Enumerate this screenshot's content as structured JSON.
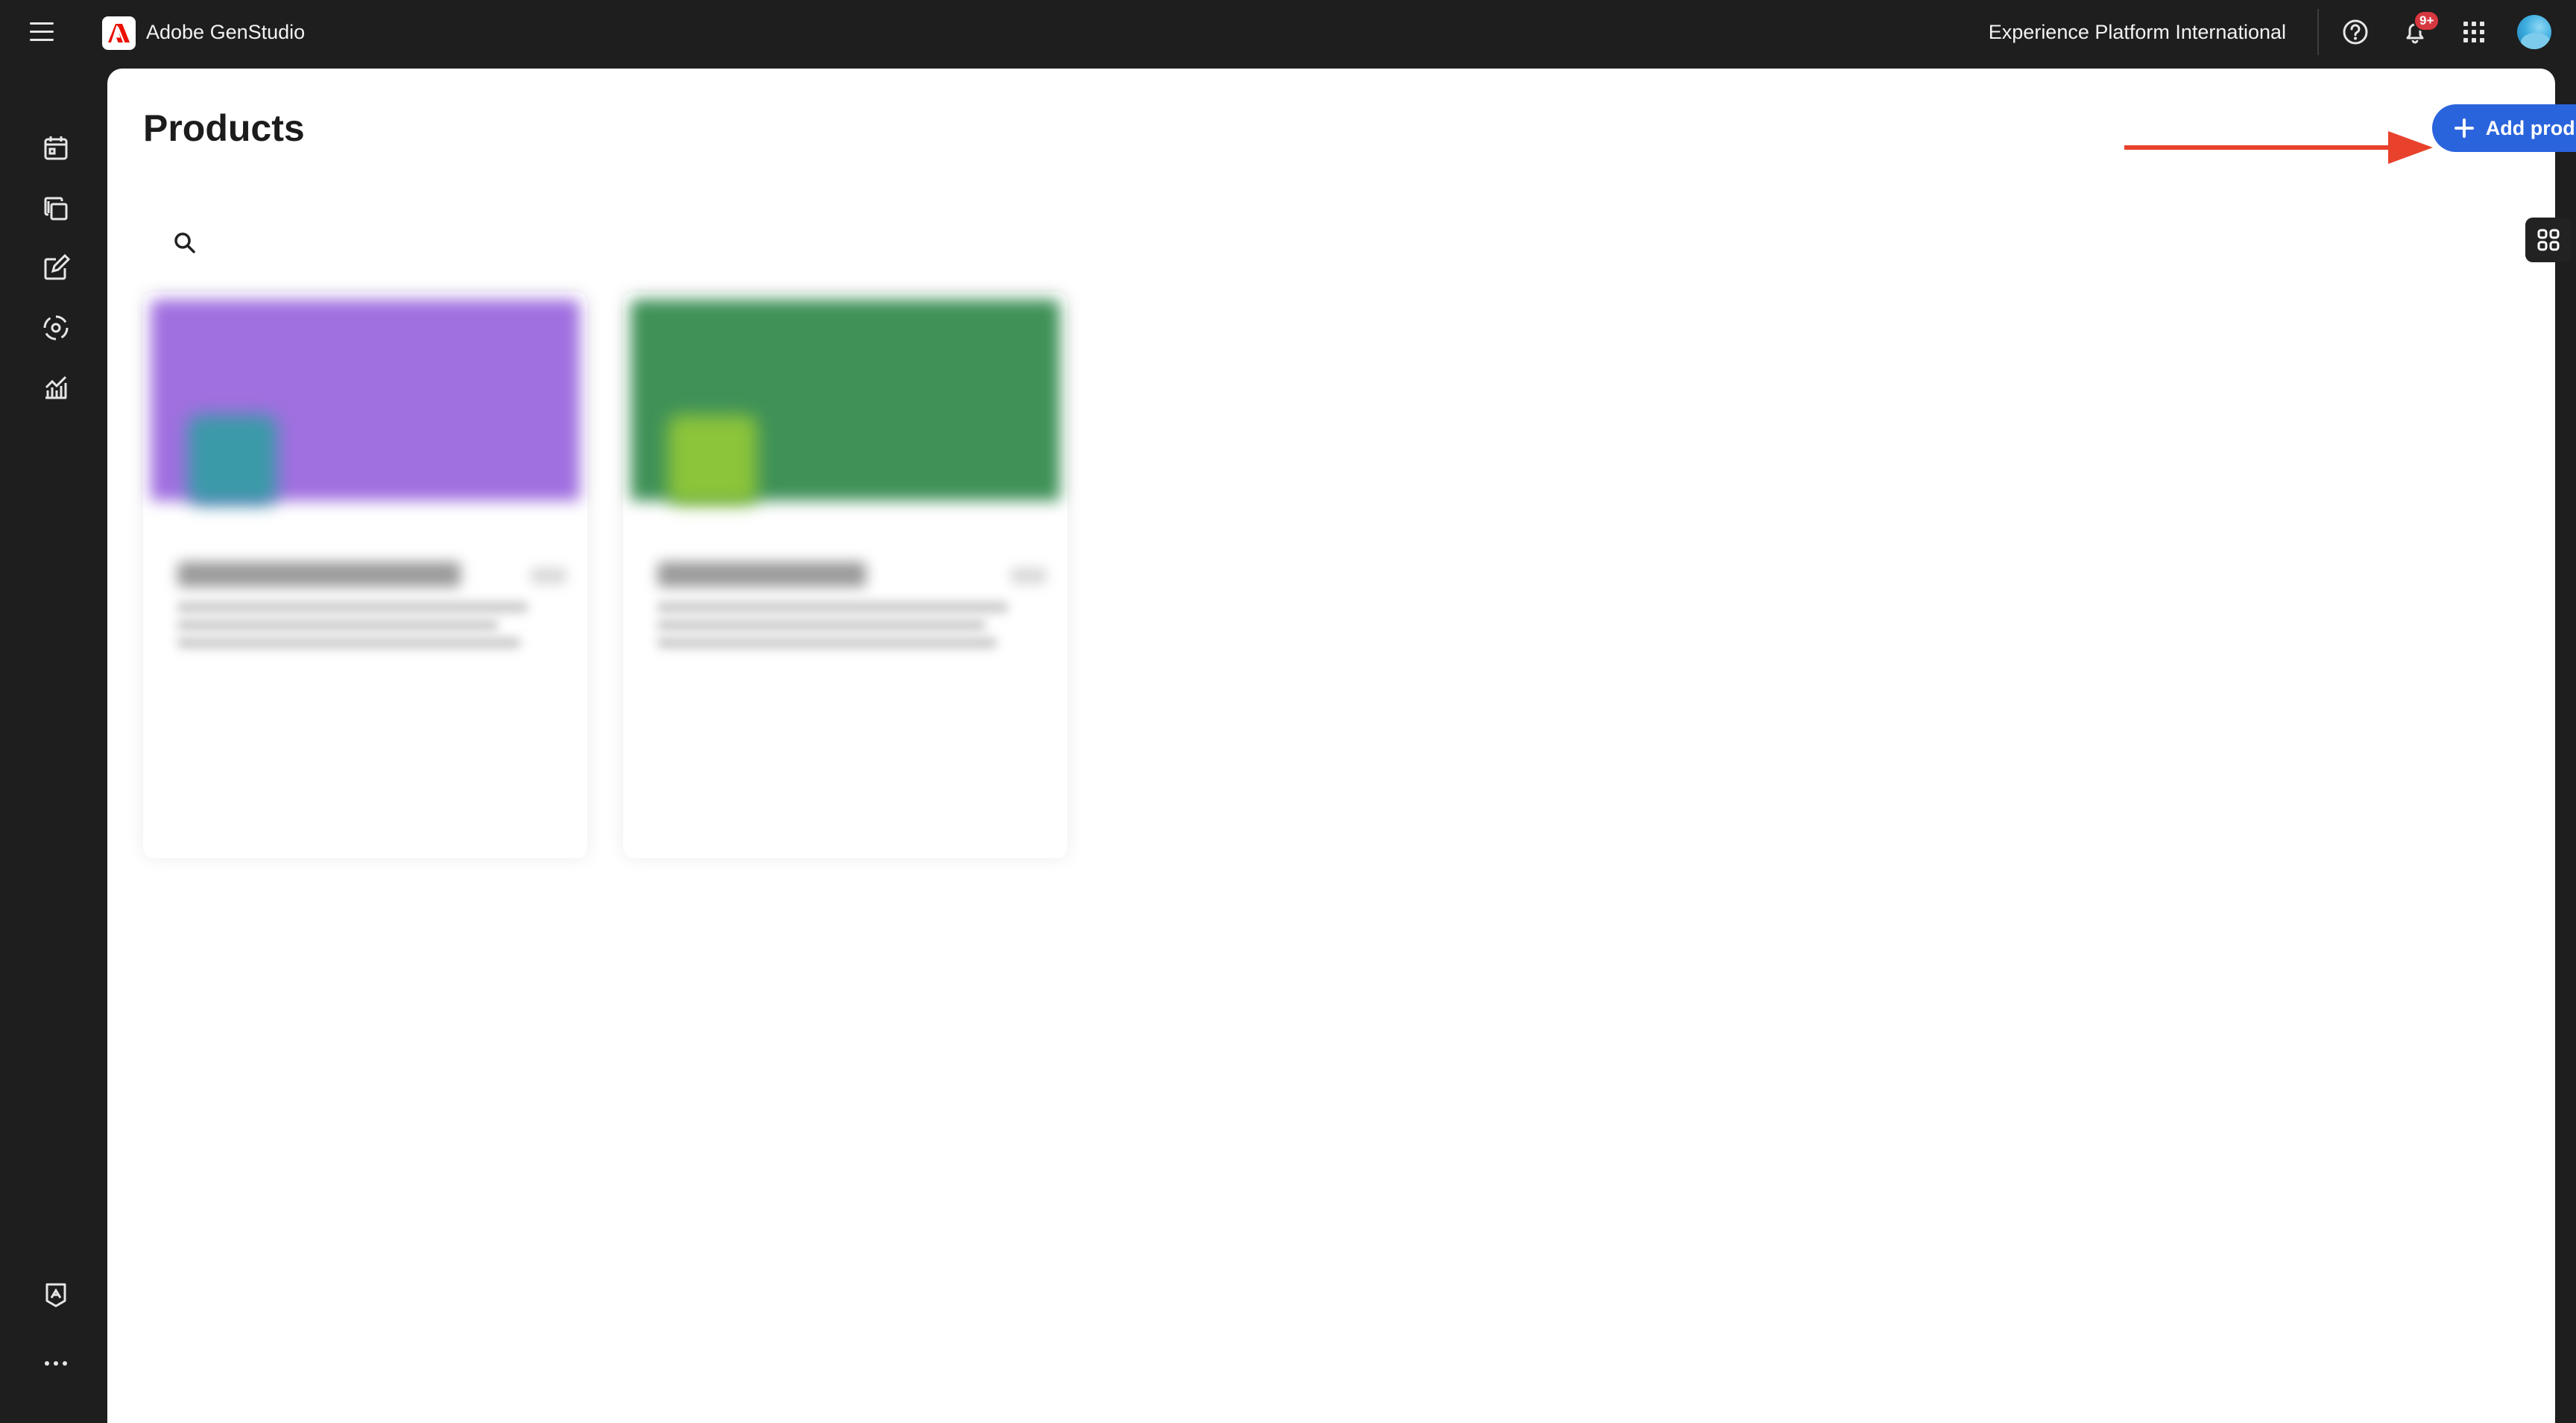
{
  "header": {
    "app_name": "Adobe GenStudio",
    "organization": "Experience Platform International",
    "notification_badge": "9+"
  },
  "sidebar": {
    "items": [
      {
        "icon": "calendar-icon"
      },
      {
        "icon": "content-icon"
      },
      {
        "icon": "create-icon"
      },
      {
        "icon": "activate-icon"
      },
      {
        "icon": "insights-icon"
      }
    ],
    "bottom_items": [
      {
        "icon": "brand-icon"
      },
      {
        "icon": "more-icon"
      }
    ]
  },
  "main": {
    "title": "Products",
    "add_button_label": "Add product",
    "view_mode": "grid"
  },
  "products": [
    {
      "banner_color": "#a070e0",
      "thumb_color": "#3a9aa8",
      "name": "",
      "description": ""
    },
    {
      "banner_color": "#3f9158",
      "thumb_color": "#8cc43a",
      "name": "",
      "description": ""
    }
  ],
  "colors": {
    "accent": "#2a64dc",
    "annotation_arrow": "#e8412c",
    "badge": "#d7373f",
    "chrome": "#1e1e1e"
  }
}
